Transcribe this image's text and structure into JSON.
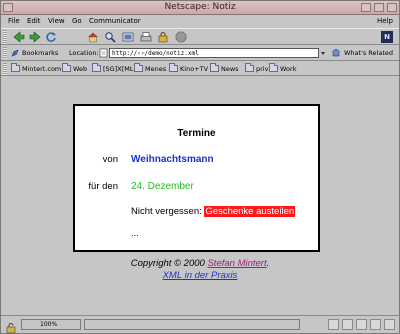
{
  "window": {
    "title": "Netscape: Notiz"
  },
  "menu": {
    "items": [
      "File",
      "Edit",
      "View",
      "Go",
      "Communicator"
    ],
    "help": "Help"
  },
  "toolbar": {
    "buttons": [
      "back-icon",
      "forward-icon",
      "reload-icon",
      "home-icon",
      "search-icon",
      "netscape-guide-icon",
      "print-icon",
      "security-icon",
      "stop-icon"
    ],
    "logo": "N"
  },
  "location": {
    "bookmarks_label": "Bookmarks",
    "location_label": "Location:",
    "url": "http://‹›/demo/notiz.xml",
    "related_label": "What's Related"
  },
  "bookmarks_bar": {
    "items": [
      "Mintert.com",
      "Web",
      "[SG]X[ML]",
      "Menes",
      "Kino+TV",
      "News",
      "priv",
      "Work"
    ]
  },
  "note": {
    "heading": "Termine",
    "from_label": "von",
    "from_value": "Weihnachtsmann",
    "for_label": "für den",
    "for_value": "24. Dezember",
    "reminder_prefix": "Nicht vergessen:",
    "reminder_highlight": "Geschenke austeilen",
    "ellipsis": "..."
  },
  "footer": {
    "copyright_prefix": "Copyright © 2000 ",
    "author": "Stefan Mintert",
    "period": ".",
    "book": "XML in der Praxis"
  },
  "status": {
    "progress": "100%"
  },
  "colors": {
    "name": "#1d33c6",
    "date": "#20c020",
    "highlight": "#ff1a1a",
    "author_link": "#a0207a"
  }
}
